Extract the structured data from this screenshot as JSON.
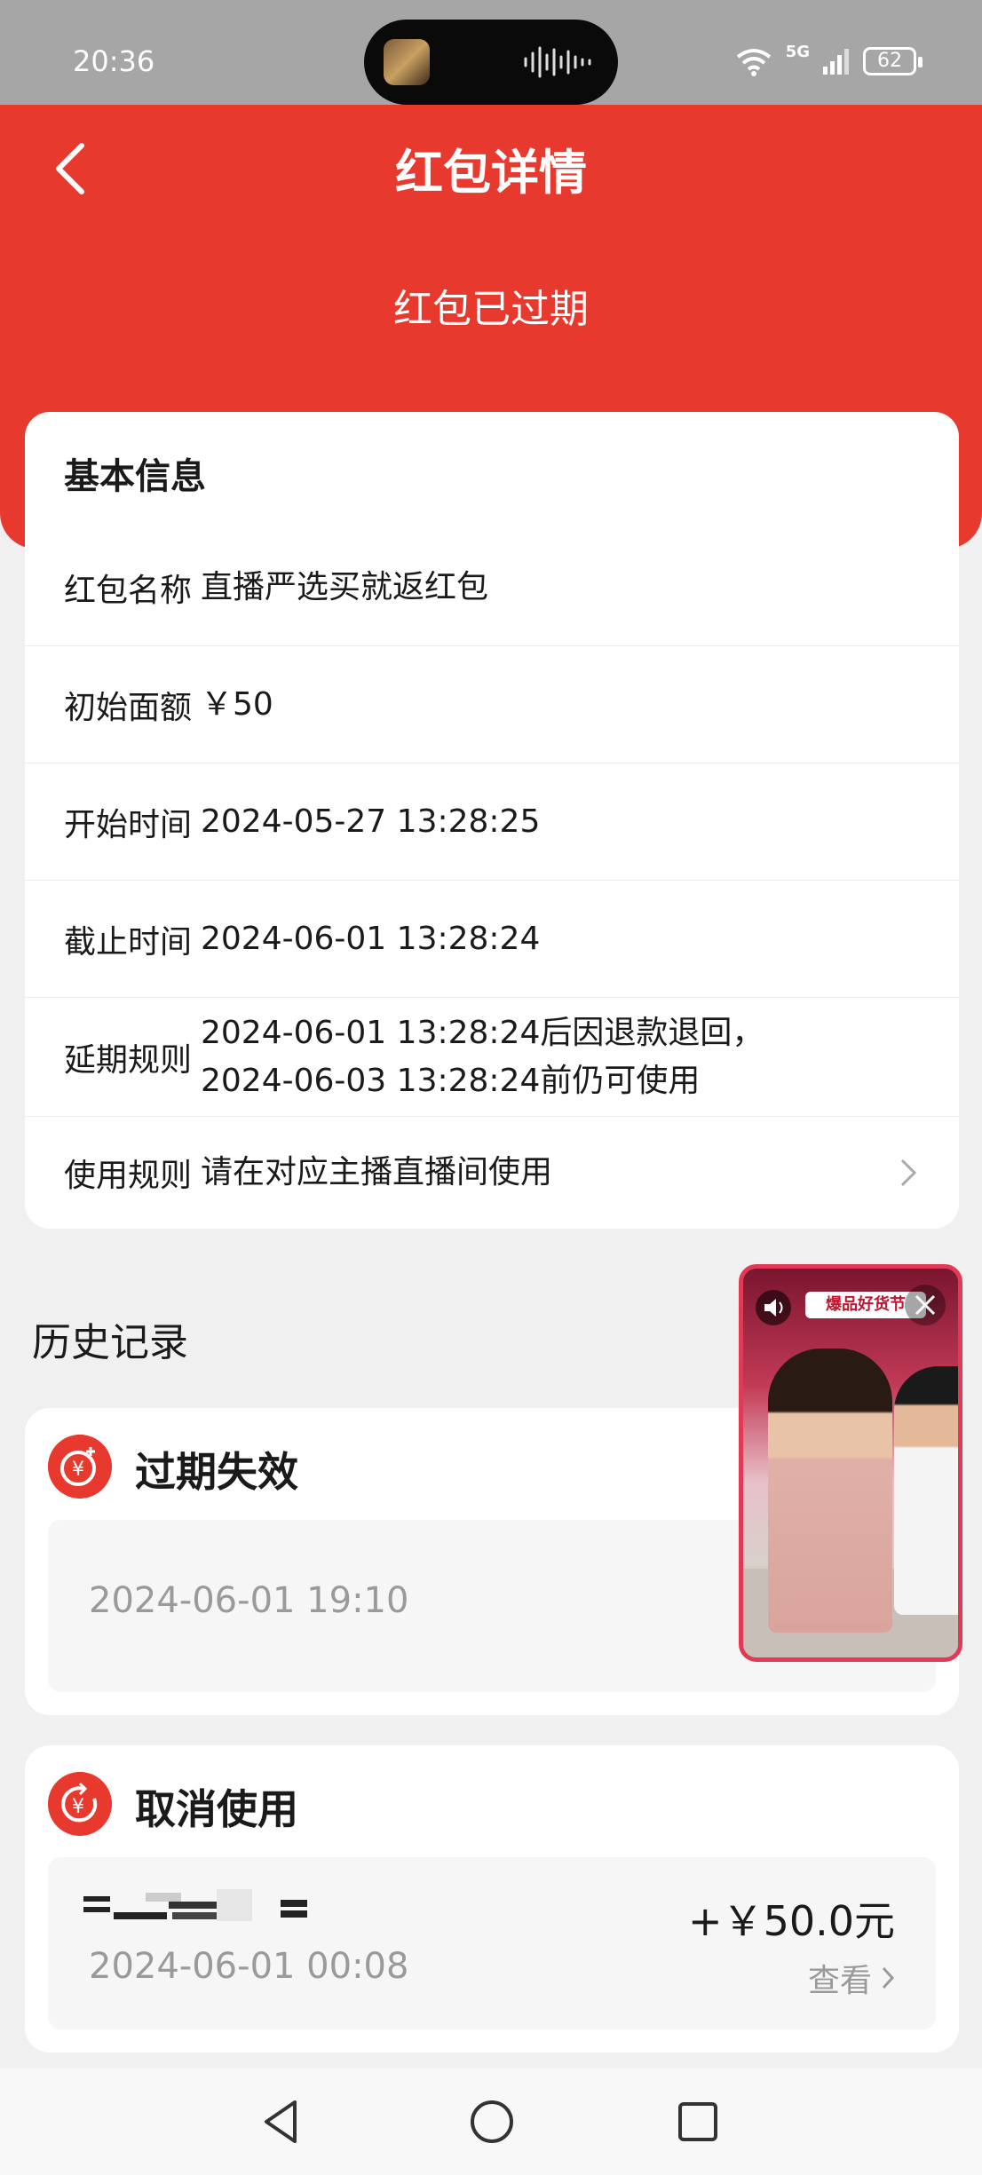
{
  "status_bar": {
    "time": "20:36",
    "network": "5G",
    "battery": "62"
  },
  "header": {
    "title": "红包详情",
    "status": "红包已过期"
  },
  "info": {
    "heading": "基本信息",
    "rows": [
      {
        "label": "红包名称",
        "value": "直播严选买就返红包"
      },
      {
        "label": "初始面额",
        "value": "￥50"
      },
      {
        "label": "开始时间",
        "value": "2024-05-27 13:28:25"
      },
      {
        "label": "截止时间",
        "value": "2024-06-01 13:28:24"
      },
      {
        "label": "延期规则",
        "value_line1": "2024-06-01 13:28:24后因退款退回，",
        "value_line2": "2024-06-03 13:28:24前仍可使用"
      },
      {
        "label": "使用规则",
        "value": "请在对应主播直播间使用"
      }
    ]
  },
  "history": {
    "title": "历史记录",
    "records": [
      {
        "title": "过期失效",
        "time": "2024-06-01 19:10"
      },
      {
        "title": "取消使用",
        "time": "2024-06-01 00:08",
        "amount": "+￥50.0元",
        "link": "查看"
      }
    ]
  },
  "pip": {
    "banner": "爆品好货节"
  },
  "colors": {
    "accent": "#e8392e",
    "pip_border": "#e03a55"
  }
}
